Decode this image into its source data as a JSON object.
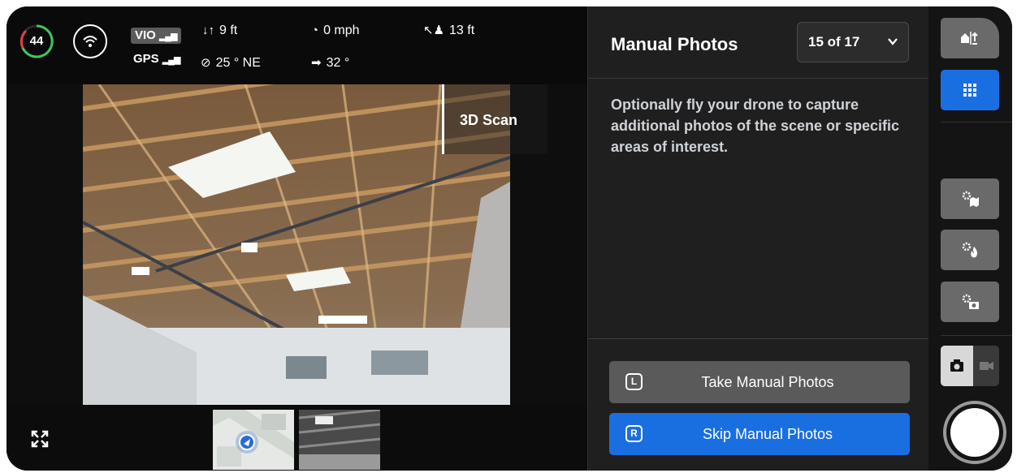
{
  "telemetry": {
    "battery": "44",
    "vio_label": "VIO",
    "gps_label": "GPS",
    "vertical_speed": "9 ft",
    "speed": "0 mph",
    "distance": "13 ft",
    "heading": "25 ° NE",
    "gimbal": "32 °",
    "icons": {
      "battery": "battery-ring-icon",
      "wifi": "wifi-icon",
      "vertical": "up-down-arrows-icon",
      "speed": "speedometer-icon",
      "distance": "drone-distance-icon",
      "heading": "compass-icon",
      "gimbal": "camera-gimbal-icon"
    }
  },
  "camera": {
    "overlay_label": "3D Scan",
    "thumbnails": [
      "map-thumbnail",
      "camera-thumbnail"
    ]
  },
  "panel": {
    "title": "Manual Photos",
    "step": "15 of 17",
    "description": "Optionally fly your drone to capture additional photos of the scene or specific areas of interest.",
    "take_key": "L",
    "take_label": "Take Manual Photos",
    "skip_key": "R",
    "skip_label": "Skip Manual Photos"
  },
  "rail": {
    "icons": [
      "home-return-icon",
      "grid-icon",
      "settings-map-icon",
      "settings-fire-icon",
      "settings-camera-icon"
    ],
    "mode_photo": "camera-icon",
    "mode_video": "video-icon"
  },
  "colors": {
    "accent": "#1a6fe0",
    "battery_green": "#3cc860",
    "battery_red": "#e04040",
    "panel_bg": "#1f1f1f"
  }
}
